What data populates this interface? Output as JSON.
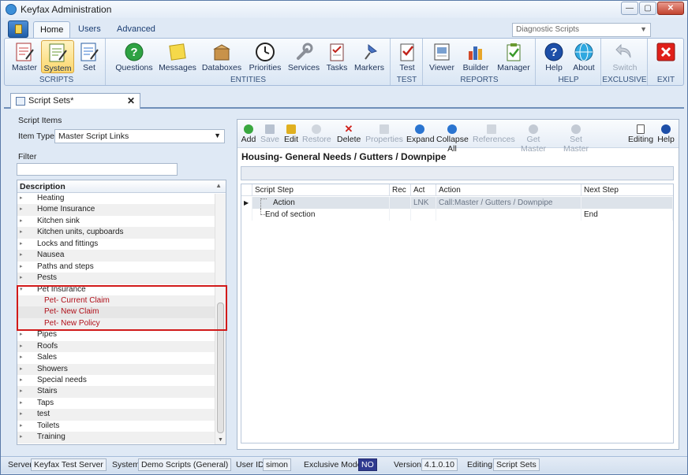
{
  "window": {
    "title": "Keyfax Administration",
    "min": "—",
    "max": "▢",
    "close": "✕"
  },
  "ribbon": {
    "tabs": [
      "Home",
      "Users",
      "Advanced"
    ],
    "script_combo": "Diagnostic Scripts",
    "groups": {
      "scripts": {
        "label": "SCRIPTS",
        "buttons": [
          "Master",
          "System",
          "Set"
        ]
      },
      "entities": {
        "label": "ENTITIES",
        "buttons": [
          "Questions",
          "Messages",
          "Databoxes",
          "Priorities",
          "Services",
          "Tasks",
          "Markers"
        ]
      },
      "test": {
        "label": "TEST",
        "buttons": [
          "Test"
        ]
      },
      "reports": {
        "label": "REPORTS",
        "buttons": [
          "Viewer",
          "Builder",
          "Manager"
        ]
      },
      "help": {
        "label": "HELP",
        "buttons": [
          "Help",
          "About"
        ]
      },
      "exclusive": {
        "label": "EXCLUSIVE",
        "buttons": [
          "Switch"
        ]
      },
      "exit": {
        "label": "EXIT"
      }
    }
  },
  "doc_tab": {
    "label": "Script Sets*",
    "close": "✕"
  },
  "left": {
    "section_label": "Script Items",
    "item_type_label": "Item Type",
    "item_type_value": "Master Script Links",
    "filter_label": "Filter",
    "filter_value": "",
    "column_header": "Description",
    "items": [
      {
        "label": "Heating",
        "expander": "▸"
      },
      {
        "label": "Home Insurance",
        "expander": "▸"
      },
      {
        "label": "Kitchen sink",
        "expander": "▸"
      },
      {
        "label": "Kitchen units, cupboards",
        "expander": "▸"
      },
      {
        "label": "Locks and fittings",
        "expander": "▸"
      },
      {
        "label": "Nausea",
        "expander": "▸"
      },
      {
        "label": "Paths and steps",
        "expander": "▸"
      },
      {
        "label": "Pests",
        "expander": "▸"
      },
      {
        "label": "Pet Insurance",
        "expander": "▾"
      },
      {
        "label": "Pet- Current Claim",
        "expander": ""
      },
      {
        "label": "Pet- New Claim",
        "expander": ""
      },
      {
        "label": "Pet- New Policy",
        "expander": ""
      },
      {
        "label": "Pipes",
        "expander": "▸"
      },
      {
        "label": "Roofs",
        "expander": "▸"
      },
      {
        "label": "Sales",
        "expander": "▸"
      },
      {
        "label": "Showers",
        "expander": "▸"
      },
      {
        "label": "Special needs",
        "expander": "▸"
      },
      {
        "label": "Stairs",
        "expander": "▸"
      },
      {
        "label": "Taps",
        "expander": "▸"
      },
      {
        "label": "test",
        "expander": "▸"
      },
      {
        "label": "Toilets",
        "expander": "▸"
      },
      {
        "label": "Training",
        "expander": "▸"
      }
    ]
  },
  "toolbar": {
    "add": "Add",
    "save": "Save",
    "edit": "Edit",
    "restore": "Restore",
    "delete": "Delete",
    "properties": "Properties",
    "expand": "Expand",
    "collapse_all": "Collapse All",
    "references": "References",
    "get_master": "Get Master",
    "set_master": "Set Master",
    "editing": "Editing",
    "help": "Help"
  },
  "right": {
    "heading": "Housing- General Needs / Gutters / Downpipe",
    "columns": [
      "Script Step",
      "Rec",
      "Act",
      "Action",
      "Next Step"
    ],
    "rows": [
      {
        "marker": "▶",
        "step": "Action",
        "rec": "",
        "act": "LNK",
        "action": "Call:Master / Gutters / Downpipe",
        "next": ""
      },
      {
        "marker": "",
        "step": "End of section",
        "rec": "",
        "act": "",
        "action": "",
        "next": "End"
      }
    ]
  },
  "status": {
    "server_label": "Server",
    "server_value": "Keyfax Test Server",
    "system_label": "System",
    "system_value": "Demo Scripts (General)",
    "userid_label": "User ID",
    "userid_value": "simon",
    "exclusive_label": "Exclusive Mode",
    "exclusive_value": "NO",
    "version_label": "Version",
    "version_value": "4.1.0.10",
    "editing_label": "Editing",
    "editing_value": "Script Sets"
  }
}
